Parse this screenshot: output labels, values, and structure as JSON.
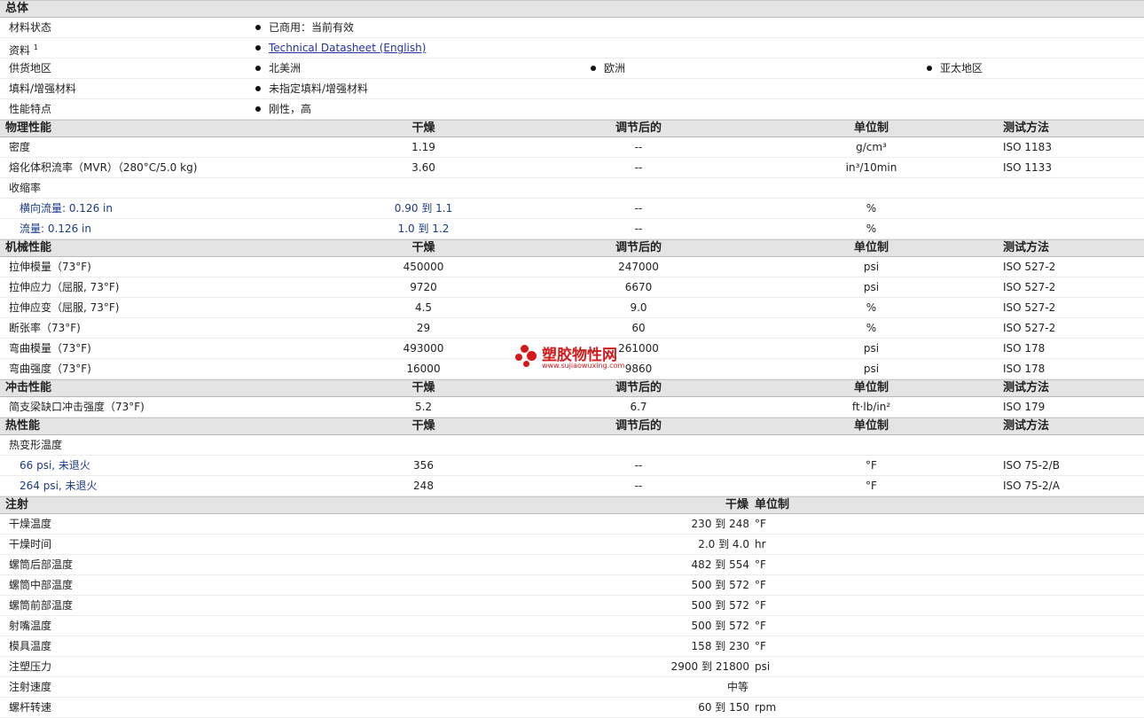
{
  "general": {
    "title": "总体",
    "material_status": {
      "label": "材料状态",
      "value": "已商用：当前有效"
    },
    "documents": {
      "label": "资料",
      "sup": "1",
      "link": "Technical Datasheet (English)"
    },
    "regions": {
      "label": "供货地区",
      "items": [
        "北美洲",
        "欧洲",
        "亚太地区"
      ]
    },
    "filler": {
      "label": "填料/增强材料",
      "value": "未指定填料/增强材料"
    },
    "features": {
      "label": "性能特点",
      "value": "刚性，高"
    }
  },
  "columns": {
    "dry": "干燥",
    "cond": "调节后的",
    "unit": "单位制",
    "test": "测试方法"
  },
  "physical": {
    "title": "物理性能",
    "density": {
      "label": "密度",
      "dry": "1.19",
      "cond": "--",
      "unit": "g/cm³",
      "test": "ISO 1183"
    },
    "mvr": {
      "label": "熔化体积流率（MVR）（280°C/5.0 kg)",
      "dry": "3.60",
      "cond": "--",
      "unit": "in³/10min",
      "test": "ISO 1133"
    },
    "shrink": {
      "label": "收缩率"
    },
    "shrink_td": {
      "label": "横向流量: 0.126 in",
      "dry": "0.90 到 1.1",
      "cond": "--",
      "unit": "%"
    },
    "shrink_md": {
      "label": "流量: 0.126 in",
      "dry": "1.0 到 1.2",
      "cond": "--",
      "unit": "%"
    }
  },
  "mechanical": {
    "title": "机械性能",
    "rows": [
      {
        "label": "拉伸模量（73°F)",
        "dry": "450000",
        "cond": "247000",
        "unit": "psi",
        "test": "ISO 527-2"
      },
      {
        "label": "拉伸应力（屈服, 73°F)",
        "dry": "9720",
        "cond": "6670",
        "unit": "psi",
        "test": "ISO 527-2"
      },
      {
        "label": "拉伸应变（屈服, 73°F)",
        "dry": "4.5",
        "cond": "9.0",
        "unit": "%",
        "test": "ISO 527-2"
      },
      {
        "label": "断张率（73°F)",
        "dry": "29",
        "cond": "60",
        "unit": "%",
        "test": "ISO 527-2"
      },
      {
        "label": "弯曲模量（73°F)",
        "dry": "493000",
        "cond": "261000",
        "unit": "psi",
        "test": "ISO 178"
      },
      {
        "label": "弯曲强度（73°F)",
        "dry": "16000",
        "cond": "9860",
        "unit": "psi",
        "test": "ISO 178"
      }
    ]
  },
  "impact": {
    "title": "冲击性能",
    "rows": [
      {
        "label": "简支梁缺口冲击强度（73°F)",
        "dry": "5.2",
        "cond": "6.7",
        "unit": "ft·lb/in²",
        "test": "ISO 179"
      }
    ]
  },
  "thermal": {
    "title": "热性能",
    "hdt": {
      "label": "热变形温度"
    },
    "rows": [
      {
        "label": "66 psi, 未退火",
        "dry": "356",
        "cond": "--",
        "unit": "°F",
        "test": "ISO 75-2/B"
      },
      {
        "label": "264 psi, 未退火",
        "dry": "248",
        "cond": "--",
        "unit": "°F",
        "test": "ISO 75-2/A"
      }
    ]
  },
  "injection": {
    "title": "注射",
    "col_dry": "干燥",
    "col_unit": "单位制",
    "rows": [
      {
        "label": "干燥温度",
        "value": "230 到 248",
        "unit": "°F"
      },
      {
        "label": "干燥时间",
        "value": "2.0 到 4.0",
        "unit": "hr"
      },
      {
        "label": "螺筒后部温度",
        "value": "482 到 554",
        "unit": "°F"
      },
      {
        "label": "螺筒中部温度",
        "value": "500 到 572",
        "unit": "°F"
      },
      {
        "label": "螺筒前部温度",
        "value": "500 到 572",
        "unit": "°F"
      },
      {
        "label": "射嘴温度",
        "value": "500 到 572",
        "unit": "°F"
      },
      {
        "label": "模具温度",
        "value": "158 到 230",
        "unit": "°F"
      },
      {
        "label": "注塑压力",
        "value": "2900 到 21800",
        "unit": "psi"
      }
    ],
    "speed": {
      "label": "注射速度",
      "value": "中等"
    },
    "screw": {
      "label": "螺杆转速",
      "value": "60 到 150",
      "unit": "rpm"
    }
  },
  "watermark": {
    "title": "塑胶物性网",
    "url": "www.sujiaowuxing.com"
  }
}
